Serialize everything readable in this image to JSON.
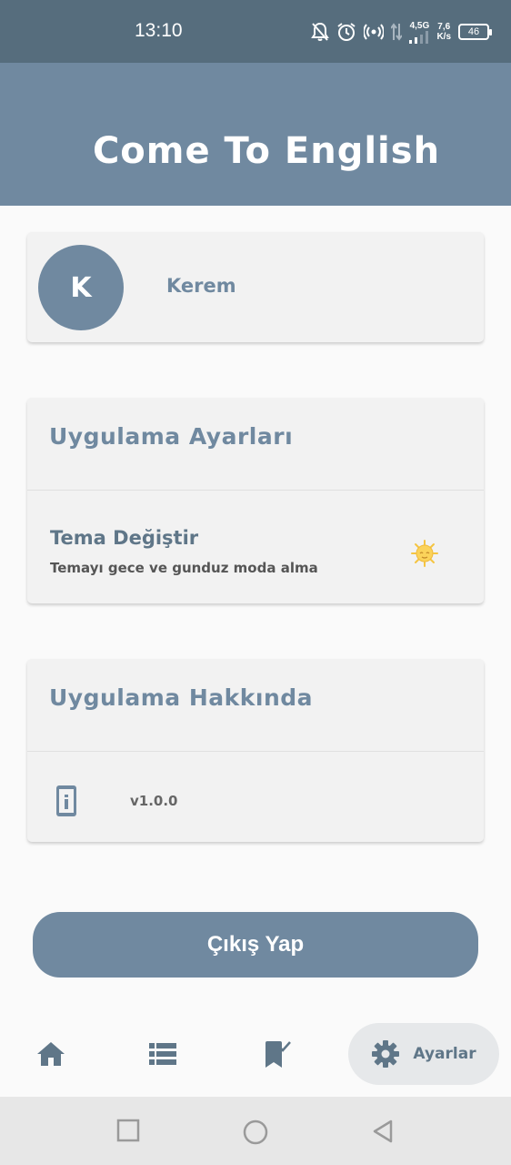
{
  "status_bar": {
    "time": "13:10",
    "network_type": "4,5G",
    "speed_value": "7,6",
    "speed_unit": "K/s",
    "battery": "46"
  },
  "app_bar": {
    "title": "Come To English"
  },
  "profile": {
    "initial": "K",
    "name": "Kerem"
  },
  "settings_section": {
    "header": "Uygulama Ayarları",
    "theme_title": "Tema Değiştir",
    "theme_subtitle": "Temayı gece ve gunduz moda alma",
    "theme_icon": "sun-icon"
  },
  "about_section": {
    "header": "Uygulama Hakkında",
    "version": "v1.0.0",
    "icon": "info-icon"
  },
  "logout_label": "Çıkış Yap",
  "bottom_nav": {
    "items": [
      {
        "icon": "home-icon",
        "label": ""
      },
      {
        "icon": "list-icon",
        "label": ""
      },
      {
        "icon": "bookmark-check-icon",
        "label": ""
      },
      {
        "icon": "gear-icon",
        "label": "Ayarlar",
        "active": true
      }
    ]
  },
  "colors": {
    "primary": "#7089a0",
    "status_bar": "#566d7d",
    "card": "#f2f2f2",
    "background": "#fafafa"
  }
}
